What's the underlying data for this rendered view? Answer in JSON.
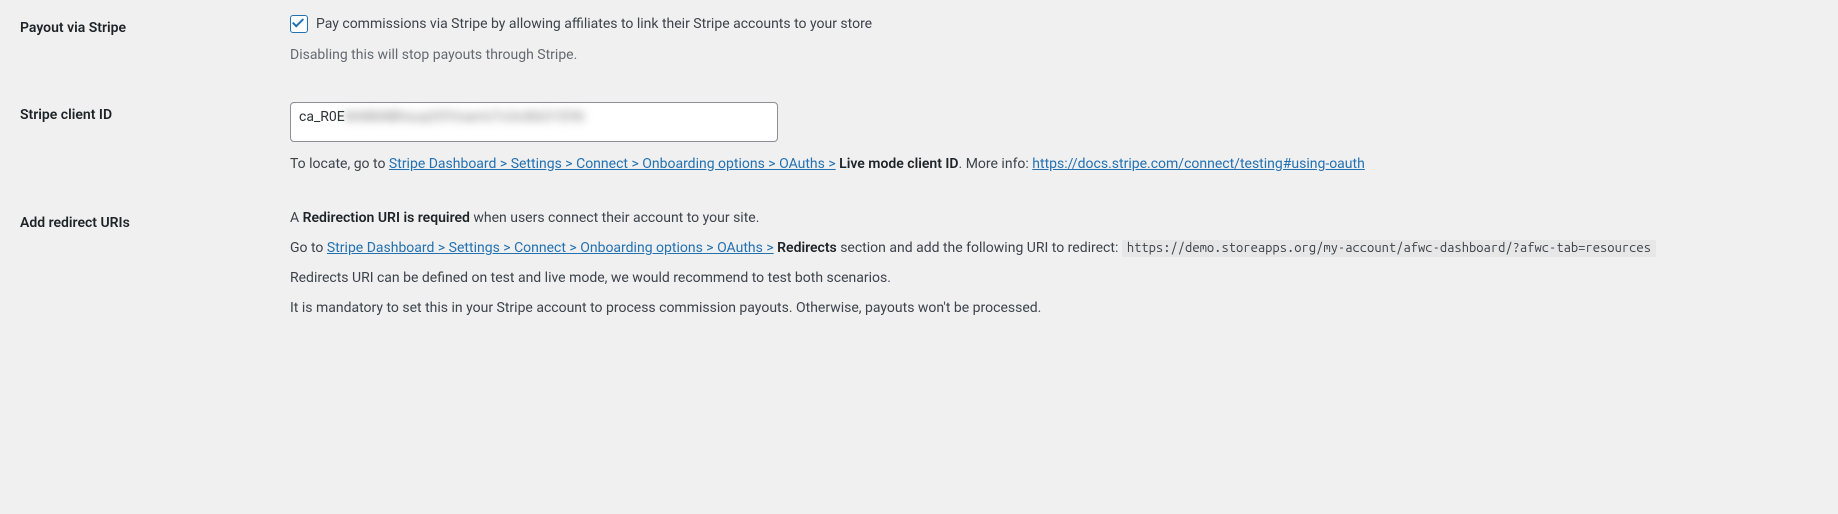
{
  "rows": {
    "payout_via_stripe": {
      "label": "Payout via Stripe",
      "checkbox_label": "Pay commissions via Stripe by allowing affiliates to link their Stripe accounts to your store",
      "checked": true,
      "description": "Disabling this will stop payouts through Stripe."
    },
    "stripe_client_id": {
      "label": "Stripe client ID",
      "value_prefix": "ca_R0E",
      "value_blurred": "NrMbNBhsuqV0YinamU7x3c86iO1E96",
      "desc_prefix": "To locate, go to ",
      "link1_text": "Stripe Dashboard > Settings > Connect > Onboarding options > OAuths >",
      "desc_mid_strong": "Live mode client ID",
      "desc_more_info": ". More info: ",
      "link2_text": "https://docs.stripe.com/connect/testing#using-oauth"
    },
    "add_redirect_uris": {
      "label": "Add redirect URIs",
      "p1_prefix": "A ",
      "p1_strong": "Redirection URI is required",
      "p1_suffix": " when users connect their account to your site.",
      "p2_prefix": "Go to ",
      "p2_link": "Stripe Dashboard > Settings > Connect > Onboarding options > OAuths >",
      "p2_strong": "Redirects",
      "p2_mid": " section and add the following URI to redirect: ",
      "p2_code": "https://demo.storeapps.org/my-account/afwc-dashboard/?afwc-tab=resources",
      "p3": "Redirects URI can be defined on test and live mode, we would recommend to test both scenarios.",
      "p4": "It is mandatory to set this in your Stripe account to process commission payouts. Otherwise, payouts won't be processed."
    }
  }
}
